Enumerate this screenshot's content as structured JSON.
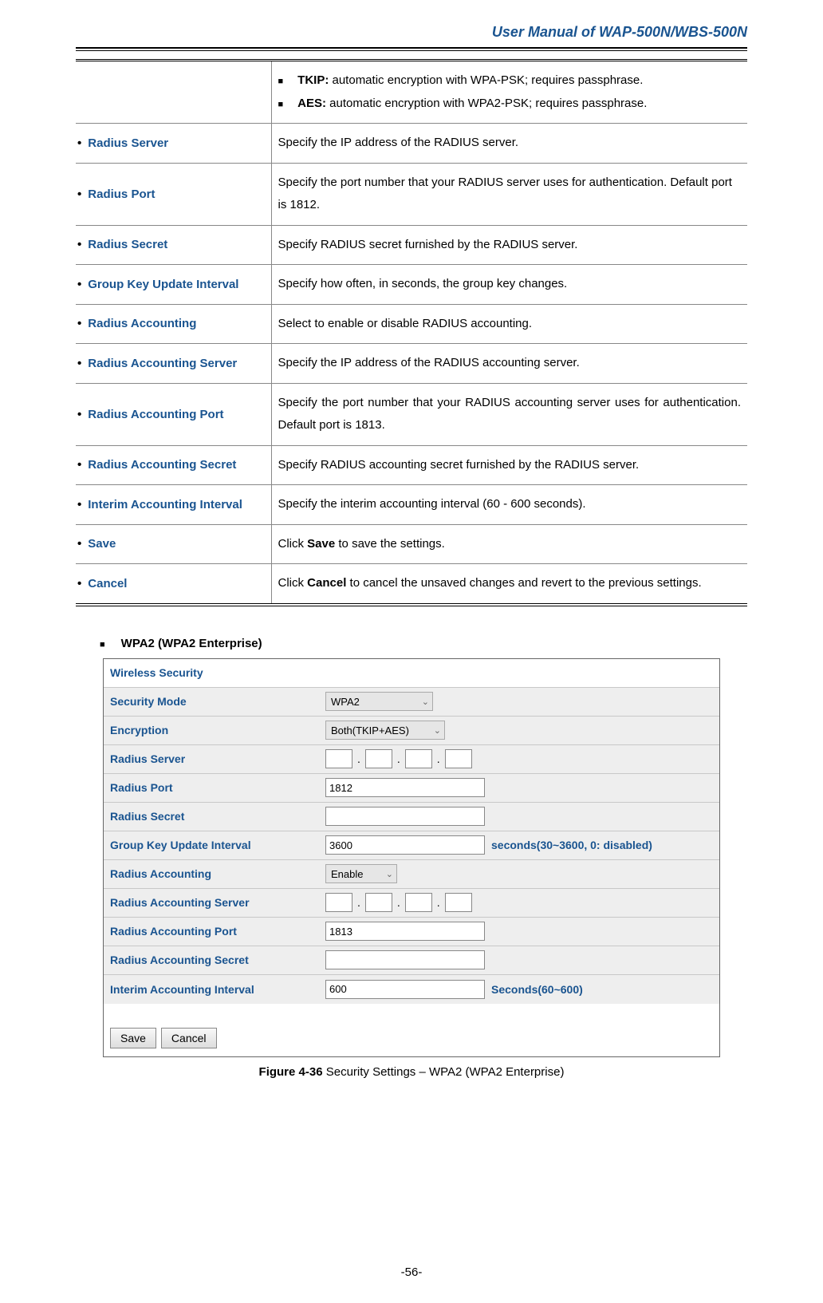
{
  "header": "User Manual of WAP-500N/WBS-500N",
  "encrypt": {
    "tkip_label": "TKIP:",
    "tkip_desc": " automatic encryption with WPA-PSK; requires passphrase.",
    "aes_label": "AES:",
    "aes_desc": " automatic encryption with WPA2-PSK; requires passphrase."
  },
  "rows": [
    {
      "label": "Radius Server",
      "desc": "Specify the IP address of the RADIUS server."
    },
    {
      "label": "Radius Port",
      "desc": "Specify the port number that your RADIUS server uses for authentication. Default port is 1812."
    },
    {
      "label": "Radius Secret",
      "desc": "Specify RADIUS secret furnished by the RADIUS server."
    },
    {
      "label": "Group Key Update Interval",
      "desc": "Specify how often, in seconds, the group key changes."
    },
    {
      "label": "Radius Accounting",
      "desc": "Select to enable or disable RADIUS accounting."
    },
    {
      "label": "Radius Accounting Server",
      "desc": "Specify the IP address of the RADIUS accounting server."
    },
    {
      "label": "Radius Accounting Port",
      "desc": "Specify the port number that your RADIUS accounting server uses for authentication. Default port is 1813."
    },
    {
      "label": "Radius Accounting Secret",
      "desc": "Specify RADIUS accounting secret furnished by the RADIUS server."
    },
    {
      "label": "Interim Accounting Interval",
      "desc": "Specify the interim accounting interval (60 - 600 seconds)."
    }
  ],
  "save_label": "Save",
  "save_desc_pre": "Click ",
  "save_desc_bold": "Save",
  "save_desc_post": " to save the settings.",
  "cancel_label": "Cancel",
  "cancel_desc_pre": "Click ",
  "cancel_desc_bold": "Cancel",
  "cancel_desc_post": " to cancel the unsaved changes and revert to the previous settings.",
  "section_heading": "WPA2 (WPA2 Enterprise)",
  "ss": {
    "title": "Wireless Security",
    "security_mode_label": "Security Mode",
    "security_mode_value": "WPA2",
    "encryption_label": "Encryption",
    "encryption_value": "Both(TKIP+AES)",
    "radius_server_label": "Radius Server",
    "radius_port_label": "Radius Port",
    "radius_port_value": "1812",
    "radius_secret_label": "Radius Secret",
    "gkui_label": "Group Key Update Interval",
    "gkui_value": "3600",
    "gkui_hint": "seconds(30~3600, 0: disabled)",
    "radius_acct_label": "Radius Accounting",
    "radius_acct_value": "Enable",
    "radius_acct_server_label": "Radius Accounting Server",
    "radius_acct_port_label": "Radius Accounting Port",
    "radius_acct_port_value": "1813",
    "radius_acct_secret_label": "Radius Accounting Secret",
    "interim_label": "Interim Accounting Interval",
    "interim_value": "600",
    "interim_hint": "Seconds(60~600)",
    "save_btn": "Save",
    "cancel_btn": "Cancel"
  },
  "figure_bold": "Figure 4-36",
  "figure_rest": " Security Settings – WPA2 (WPA2 Enterprise)",
  "page_num": "-56-"
}
